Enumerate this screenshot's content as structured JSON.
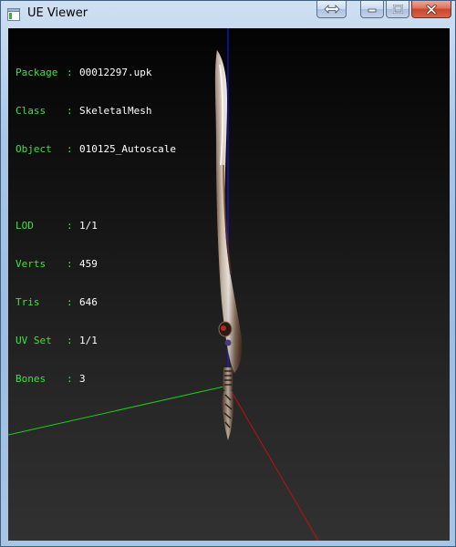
{
  "window": {
    "title": "UE Viewer"
  },
  "info": {
    "block1": [
      {
        "label": "Package",
        "value": "00012297.upk"
      },
      {
        "label": "Class",
        "value": "SkeletalMesh"
      },
      {
        "label": "Object",
        "value": "010125_Autoscale"
      }
    ],
    "block2": [
      {
        "label": "LOD",
        "value": "1/1"
      },
      {
        "label": "Verts",
        "value": "459"
      },
      {
        "label": "Tris",
        "value": "646"
      },
      {
        "label": "UV Set",
        "value": "1/1"
      },
      {
        "label": "Bones",
        "value": "3"
      }
    ],
    "separator": ":"
  },
  "colors": {
    "label": "#3fe23f",
    "value": "#ffffff",
    "axis_x": "#c01010",
    "axis_y": "#19d019",
    "axis_z": "#1a1aff"
  },
  "icons": {
    "app": "window-app-icon",
    "swap": "arrows-left-right-icon",
    "minimize": "minimize-icon",
    "maximize": "maximize-icon",
    "close": "close-icon"
  }
}
